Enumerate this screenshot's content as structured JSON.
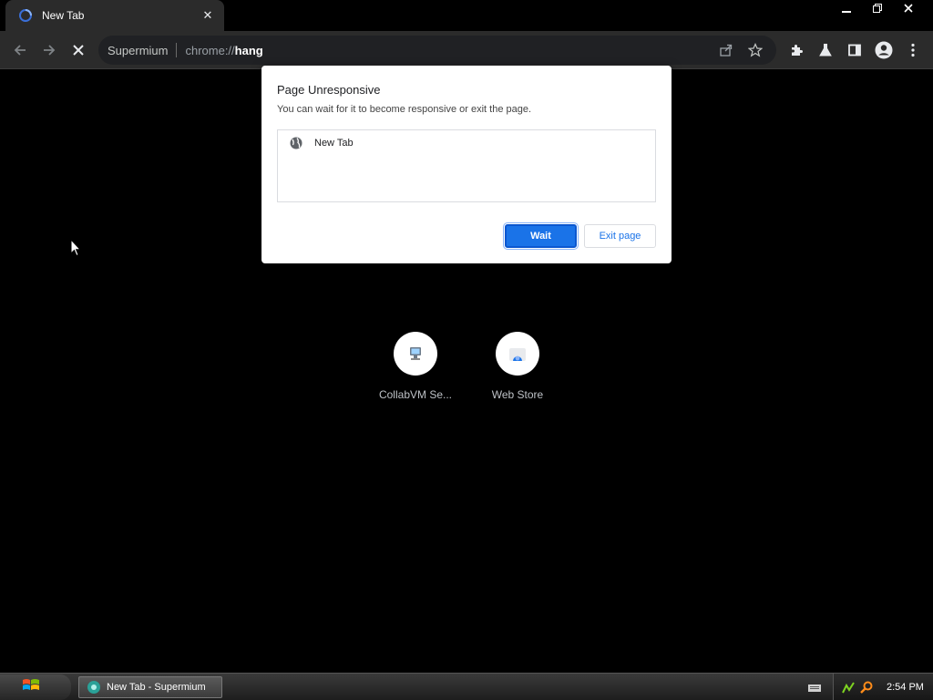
{
  "tab": {
    "title": "New Tab"
  },
  "omnibox": {
    "chip": "Supermium",
    "scheme": "chrome://",
    "host": "hang"
  },
  "dialog": {
    "title": "Page Unresponsive",
    "message": "You can wait for it to become responsive or exit the page.",
    "pages": [
      {
        "title": "New Tab"
      }
    ],
    "wait_label": "Wait",
    "exit_label": "Exit page"
  },
  "shortcuts": [
    {
      "label": "CollabVM Se..."
    },
    {
      "label": "Web Store"
    }
  ],
  "taskbar": {
    "task_label": "New Tab - Supermium",
    "clock": "2:54 PM"
  },
  "colors": {
    "accent": "#1a73e8",
    "toolbar": "#2b2b2b",
    "background": "#000000"
  }
}
